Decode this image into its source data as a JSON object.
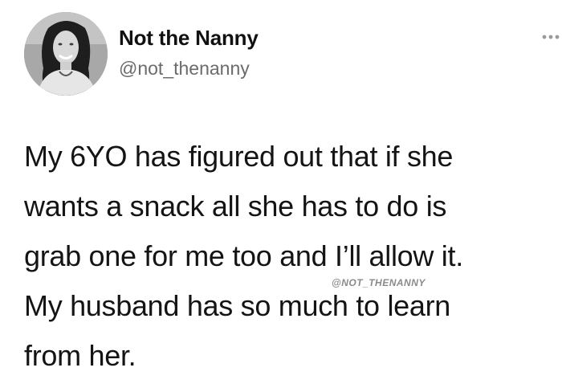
{
  "author": {
    "display_name": "Not the Nanny",
    "handle": "@not_thenanny",
    "avatar_icon": "profile-photo"
  },
  "header": {
    "more_icon": "more-options-icon"
  },
  "tweet": {
    "lines": [
      "My 6YO has figured out that if she",
      "wants a snack all she has to do is",
      "grab one for me too and I’ll allow it.",
      "My husband has so much to learn",
      "from her."
    ]
  },
  "watermark": {
    "text": "@NOT_THENANNY"
  },
  "colors": {
    "background": "#ffffff",
    "text": "#141414",
    "handle": "#6b6b6b"
  }
}
